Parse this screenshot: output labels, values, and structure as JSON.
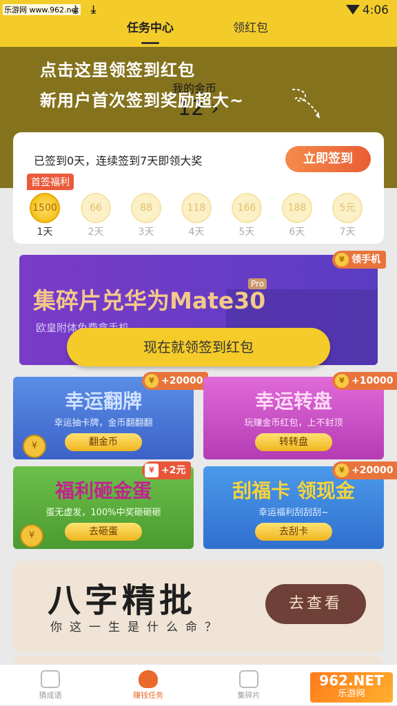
{
  "status_bar": {
    "source": "乐游网 www.962.net",
    "time": "4:06"
  },
  "tabs": [
    {
      "label": "任务中心",
      "active": true
    },
    {
      "label": "领红包",
      "active": false
    }
  ],
  "coins": {
    "label": "我的金币",
    "value": "12"
  },
  "guide": {
    "line1": "点击这里领签到红包",
    "line2": "新用户首次签到奖励超大~"
  },
  "sign_in": {
    "text": "已签到0天，连续签到7天即领大奖",
    "button": "立即签到",
    "first_badge": "首签福利",
    "days": [
      {
        "reward": "1500",
        "label": "1天"
      },
      {
        "reward": "66",
        "label": "2天"
      },
      {
        "reward": "88",
        "label": "3天"
      },
      {
        "reward": "118",
        "label": "4天"
      },
      {
        "reward": "166",
        "label": "5天"
      },
      {
        "reward": "188",
        "label": "6天"
      },
      {
        "reward": "5元",
        "label": "7天"
      }
    ]
  },
  "banner": {
    "title": "集碎片兑华为Mate30",
    "pro": "Pro",
    "subtitle": "欧皇附体免费拿手机",
    "badge": "领手机"
  },
  "cta": "现在就领签到红包",
  "cards": [
    {
      "title": "幸运翻牌",
      "desc": "幸运抽卡牌，金币翻翻翻",
      "button": "翻金币",
      "badge": "+20000",
      "color": "#3f6fd2"
    },
    {
      "title": "幸运转盘",
      "desc": "玩赚金币红包，上不封顶",
      "button": "转转盘",
      "badge": "+10000",
      "color": "#c84ac0"
    },
    {
      "title": "福利砸金蛋",
      "desc": "蛋无虚发，100%中奖砸砸砸",
      "button": "去砸蛋",
      "badge": "+2元",
      "color": "#56a83a"
    },
    {
      "title": "刮福卡 领现金",
      "desc": "幸运福利刮刮刮~",
      "button": "去刮卡",
      "badge": "+20000",
      "color": "#3a86d8"
    }
  ],
  "fortune": {
    "title": "八字精批",
    "subtitle": "你这一生是什么命？",
    "button": "去查看"
  },
  "nav": [
    {
      "label": "猜成语",
      "active": false
    },
    {
      "label": "赚钱任务",
      "active": true
    },
    {
      "label": "集碎片",
      "active": false
    }
  ],
  "watermark": {
    "brand": "962.NET",
    "site": "乐游网"
  }
}
